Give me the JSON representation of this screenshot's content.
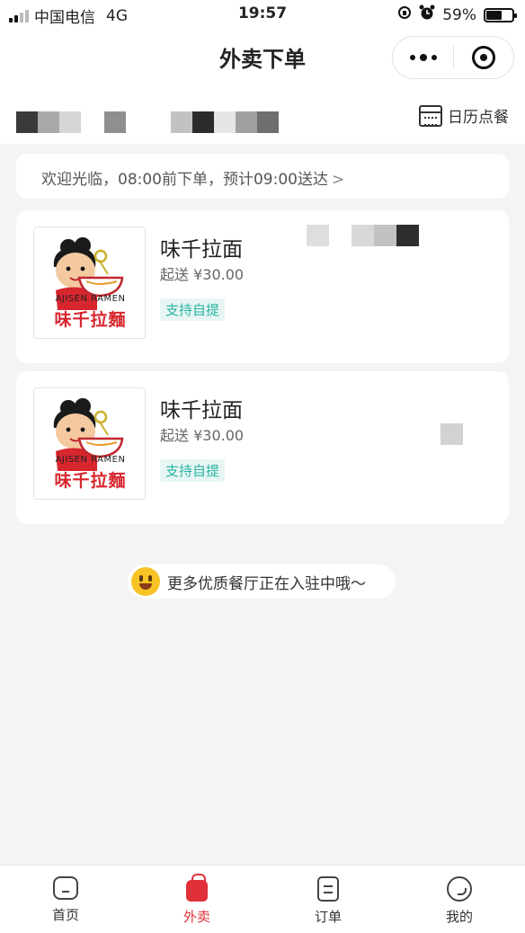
{
  "status_bar": {
    "carrier": "中国电信",
    "network": "4G",
    "time": "19:57",
    "battery": "59%",
    "battery_level": 0.59
  },
  "nav": {
    "title": "外卖下单"
  },
  "calendar_button": {
    "label": "日历点餐"
  },
  "notice": {
    "text": "欢迎光临，08:00前下单，预计09:00送达",
    "chevron": ">"
  },
  "restaurants": [
    {
      "name": "味千拉面",
      "min_order": "起送 ¥30.00",
      "tag": "支持自提",
      "logo_caption": "AJISEN RAMEN",
      "logo_text": "味千拉麵"
    },
    {
      "name": "味千拉面",
      "min_order": "起送 ¥30.00",
      "tag": "支持自提",
      "logo_caption": "AJISEN RAMEN",
      "logo_text": "味千拉麵"
    }
  ],
  "more_text": "更多优质餐厅正在入驻中哦～",
  "tabs": [
    {
      "label": "首页",
      "icon": "home-icon"
    },
    {
      "label": "外卖",
      "icon": "takeout-bag-icon"
    },
    {
      "label": "订单",
      "icon": "order-list-icon"
    },
    {
      "label": "我的",
      "icon": "profile-icon"
    }
  ],
  "colors": {
    "accent_red": "#e0303a",
    "tag_teal": "#2bb3a3",
    "background": "#f4f4f4"
  }
}
